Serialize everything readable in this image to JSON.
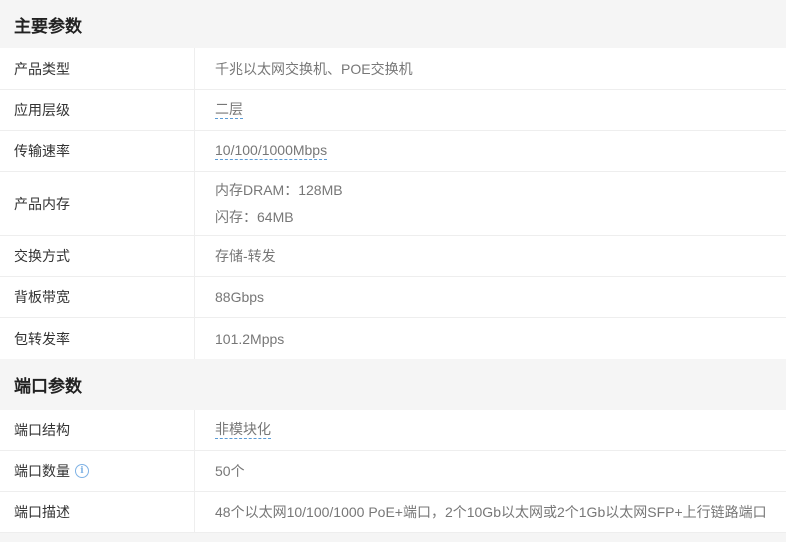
{
  "sections": [
    {
      "title": "主要参数",
      "rows": [
        {
          "label": "产品类型",
          "value": "千兆以太网交换机、POE交换机"
        },
        {
          "label": "应用层级",
          "value": "二层"
        },
        {
          "label": "传输速率",
          "value": "10/100/1000Mbps"
        },
        {
          "label": "产品内存",
          "value_line1": "内存DRAM：128MB",
          "value_line2": "闪存：64MB"
        },
        {
          "label": "交换方式",
          "value": "存储-转发"
        },
        {
          "label": "背板带宽",
          "value": "88Gbps"
        },
        {
          "label": "包转发率",
          "value": "101.2Mpps"
        }
      ]
    },
    {
      "title": "端口参数",
      "rows": [
        {
          "label": "端口结构",
          "value": "非模块化"
        },
        {
          "label": "端口数量",
          "value": "50个",
          "icon": "info-icon"
        },
        {
          "label": "端口描述",
          "value": "48个以太网10/100/1000 PoE+端口，2个10Gb以太网或2个1Gb以太网SFP+上行链路端口"
        }
      ]
    }
  ],
  "colors": {
    "link_underline": "#5b9bd5",
    "header_bg": "#f5f5f5",
    "value_text": "#777777"
  }
}
